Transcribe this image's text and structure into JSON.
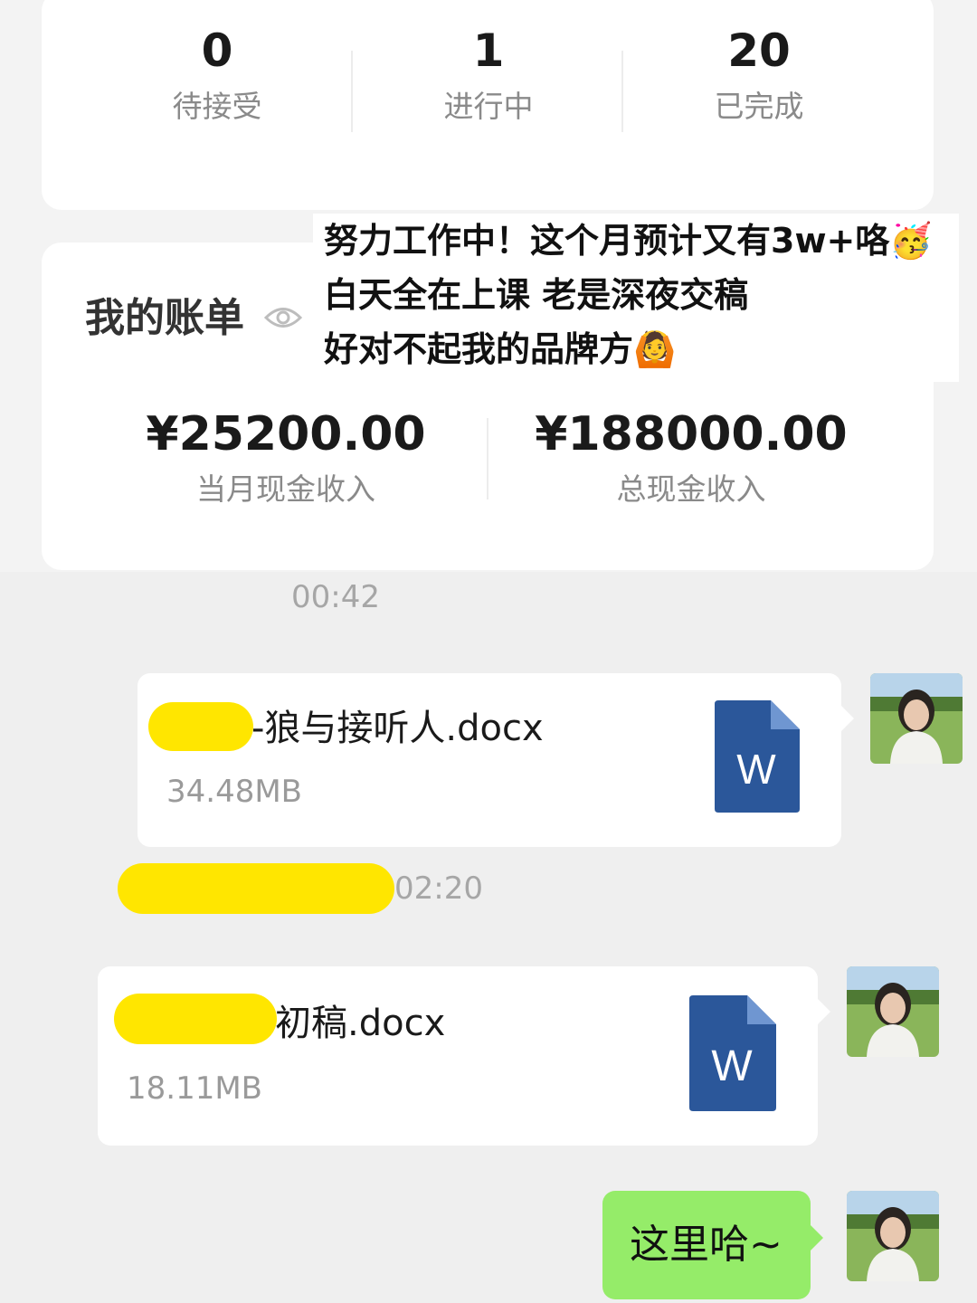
{
  "stats": [
    {
      "value": "0",
      "label": "待接受"
    },
    {
      "value": "1",
      "label": "进行中"
    },
    {
      "value": "20",
      "label": "已完成"
    }
  ],
  "bill": {
    "title": "我的账单",
    "icon": "eye-icon",
    "monthly": {
      "value": "¥25200.00",
      "label": "当月现金收入"
    },
    "total": {
      "value": "¥188000.00",
      "label": "总现金收入"
    }
  },
  "caption": {
    "lines": [
      "努力工作中！这个月预计又有3w+咯🥳",
      "白天全在上课 老是深夜交稿",
      "好对不起我的品牌方🙆"
    ]
  },
  "chat": {
    "time1": "00:42",
    "file1": {
      "name": "-狼与接听人.docx",
      "size": "34.48MB",
      "icon_letter": "W"
    },
    "time2": "02:20",
    "file2": {
      "name": "初稿.docx",
      "size": "18.11MB",
      "icon_letter": "W"
    },
    "message": "这里哈~"
  },
  "colors": {
    "word_blue": "#2b579a",
    "green_bubble": "#95ec69",
    "redaction_yellow": "#ffe600"
  }
}
